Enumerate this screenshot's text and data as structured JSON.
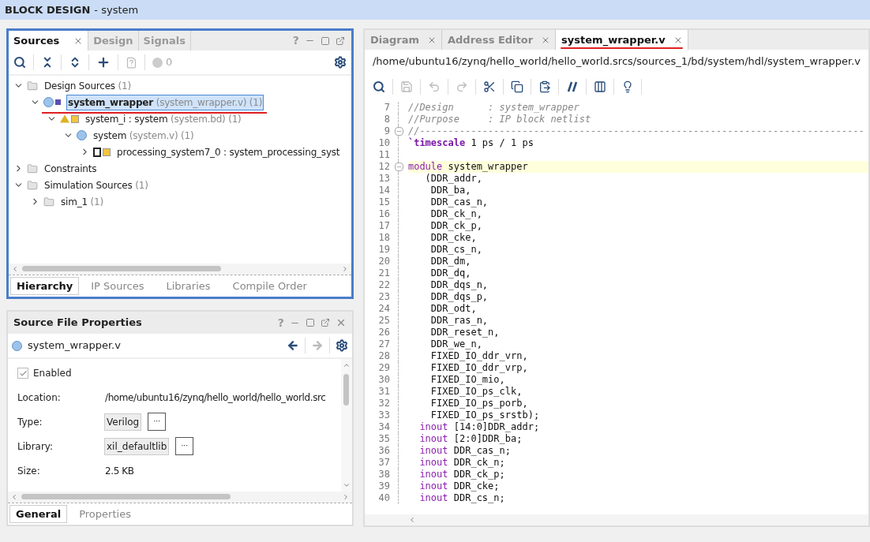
{
  "window": {
    "title": "BLOCK DESIGN",
    "subtitle": "- system"
  },
  "sources_panel": {
    "tabs": [
      {
        "label": "Sources",
        "selected": true
      },
      {
        "label": "Design",
        "selected": false
      },
      {
        "label": "Signals",
        "selected": false
      }
    ],
    "help": "?",
    "warning_count": "0",
    "tree": [
      {
        "label": "Design Sources",
        "detail": "(1)",
        "kind": "folder",
        "expanded": true,
        "selected": false,
        "children": [
          {
            "label": "system_wrapper",
            "detail": "(system_wrapper.v) (1)",
            "kind": "verilog-top",
            "expanded": true,
            "selected": true,
            "children": [
              {
                "label": "system_i : system",
                "detail": "(system.bd) (1)",
                "kind": "bd",
                "expanded": true,
                "selected": false,
                "children": [
                  {
                    "label": "system",
                    "detail": "(system.v) (1)",
                    "kind": "verilog",
                    "expanded": true,
                    "selected": false,
                    "children": [
                      {
                        "label": "processing_system7_0 : system_processing_syst",
                        "kind": "ip",
                        "expanded": false,
                        "selected": false
                      }
                    ]
                  }
                ]
              }
            ]
          }
        ]
      },
      {
        "label": "Constraints",
        "kind": "folder",
        "expanded": false,
        "selected": false
      },
      {
        "label": "Simulation Sources",
        "detail": "(1)",
        "kind": "folder",
        "expanded": true,
        "selected": false,
        "children": [
          {
            "label": "sim_1",
            "detail": "(1)",
            "kind": "folder",
            "expanded": false,
            "selected": false
          }
        ]
      }
    ],
    "bottom_tabs": [
      {
        "label": "Hierarchy",
        "selected": true
      },
      {
        "label": "IP Sources",
        "selected": false
      },
      {
        "label": "Libraries",
        "selected": false
      },
      {
        "label": "Compile Order",
        "selected": false
      }
    ]
  },
  "properties_panel": {
    "title": "Source File Properties",
    "help": "?",
    "file": "system_wrapper.v",
    "enabled": {
      "label": "Enabled",
      "checked": true
    },
    "rows": [
      {
        "label": "Location:",
        "value": "/home/ubuntu16/zynq/hello_world/hello_world.src",
        "kind": "text"
      },
      {
        "label": "Type:",
        "value": "Verilog",
        "kind": "choice",
        "button": "···"
      },
      {
        "label": "Library:",
        "value": "xil_defaultlib",
        "kind": "choice",
        "button": "···"
      },
      {
        "label": "Size:",
        "value": "2.5 KB",
        "kind": "text"
      }
    ],
    "bottom_tabs": [
      {
        "label": "General",
        "selected": true
      },
      {
        "label": "Properties",
        "selected": false
      }
    ]
  },
  "editor": {
    "tabs": [
      {
        "label": "Diagram",
        "selected": false
      },
      {
        "label": "Address Editor",
        "selected": false
      },
      {
        "label": "system_wrapper.v",
        "selected": true
      }
    ],
    "path": "/home/ubuntu16/zynq/hello_world/hello_world.srcs/sources_1/bd/system/hdl/system_wrapper.v",
    "lines": [
      {
        "n": "7",
        "kind": "comment",
        "text": "//Design      : system_wrapper"
      },
      {
        "n": "8",
        "kind": "comment",
        "text": "//Purpose     : IP block netlist"
      },
      {
        "n": "9",
        "kind": "comment",
        "fold": true,
        "text": "//------------------------------------------------------------------------------"
      },
      {
        "n": "10",
        "kind": "directive",
        "kw": "`timescale",
        "text": " 1 ps / 1 ps"
      },
      {
        "n": "11"
      },
      {
        "n": "12",
        "kind": "keyword",
        "fold": true,
        "highlighted": true,
        "kw": "module",
        "text": " system_wrapper"
      },
      {
        "n": "13",
        "kind": "plain",
        "text": "   (DDR_addr,"
      },
      {
        "n": "14",
        "kind": "plain",
        "text": "    DDR_ba,"
      },
      {
        "n": "15",
        "kind": "plain",
        "text": "    DDR_cas_n,"
      },
      {
        "n": "16",
        "kind": "plain",
        "text": "    DDR_ck_n,"
      },
      {
        "n": "17",
        "kind": "plain",
        "text": "    DDR_ck_p,"
      },
      {
        "n": "18",
        "kind": "plain",
        "text": "    DDR_cke,"
      },
      {
        "n": "19",
        "kind": "plain",
        "text": "    DDR_cs_n,"
      },
      {
        "n": "20",
        "kind": "plain",
        "text": "    DDR_dm,"
      },
      {
        "n": "21",
        "kind": "plain",
        "text": "    DDR_dq,"
      },
      {
        "n": "22",
        "kind": "plain",
        "text": "    DDR_dqs_n,"
      },
      {
        "n": "23",
        "kind": "plain",
        "text": "    DDR_dqs_p,"
      },
      {
        "n": "24",
        "kind": "plain",
        "text": "    DDR_odt,"
      },
      {
        "n": "25",
        "kind": "plain",
        "text": "    DDR_ras_n,"
      },
      {
        "n": "26",
        "kind": "plain",
        "text": "    DDR_reset_n,"
      },
      {
        "n": "27",
        "kind": "plain",
        "text": "    DDR_we_n,"
      },
      {
        "n": "28",
        "kind": "plain",
        "text": "    FIXED_IO_ddr_vrn,"
      },
      {
        "n": "29",
        "kind": "plain",
        "text": "    FIXED_IO_ddr_vrp,"
      },
      {
        "n": "30",
        "kind": "plain",
        "text": "    FIXED_IO_mio,"
      },
      {
        "n": "31",
        "kind": "plain",
        "text": "    FIXED_IO_ps_clk,"
      },
      {
        "n": "32",
        "kind": "plain",
        "text": "    FIXED_IO_ps_porb,"
      },
      {
        "n": "33",
        "kind": "plain",
        "text": "    FIXED_IO_ps_srstb);"
      },
      {
        "n": "34",
        "kind": "keyword",
        "kw": "  inout",
        "text": " [14:0]DDR_addr;"
      },
      {
        "n": "35",
        "kind": "keyword",
        "kw": "  inout",
        "text": " [2:0]DDR_ba;"
      },
      {
        "n": "36",
        "kind": "keyword",
        "kw": "  inout",
        "text": " DDR_cas_n;"
      },
      {
        "n": "37",
        "kind": "keyword",
        "kw": "  inout",
        "text": " DDR_ck_n;"
      },
      {
        "n": "38",
        "kind": "keyword",
        "kw": "  inout",
        "text": " DDR_ck_p;"
      },
      {
        "n": "39",
        "kind": "keyword",
        "kw": "  inout",
        "text": " DDR_cke;"
      },
      {
        "n": "40",
        "kind": "keyword",
        "kw": "  inout",
        "text": " DDR_cs_n;"
      }
    ]
  }
}
